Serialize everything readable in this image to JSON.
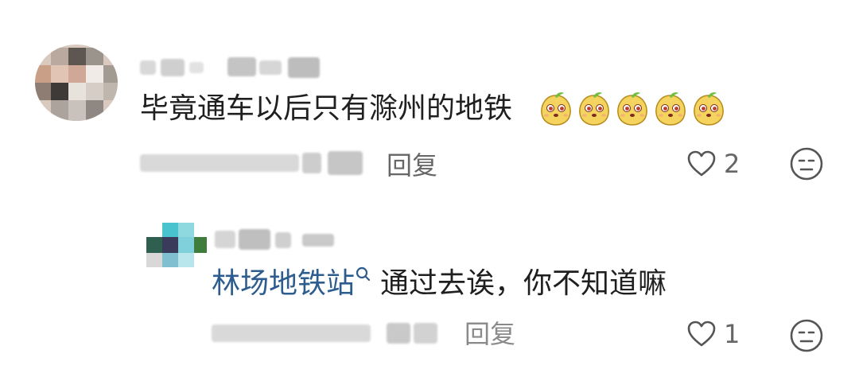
{
  "comment": {
    "text": "毕竟通车以后只有滁州的地铁",
    "emoji_icons": [
      "mango-face-emoji",
      "mango-face-emoji",
      "mango-face-emoji",
      "mango-face-emoji",
      "mango-face-emoji"
    ],
    "reply_label": "回复",
    "like_count": "2"
  },
  "reply": {
    "mention": "林场地铁站",
    "text": "通过去诶，你不知道嘛",
    "reply_label": "回复",
    "like_count": "1"
  },
  "icons": {
    "like": "heart-outline-icon",
    "reaction": "neutral-face-icon",
    "mention_search": "search-icon"
  },
  "colors": {
    "text": "#1f1f1f",
    "meta": "#666666",
    "mention_link": "#2d5c8f",
    "icon": "#555555"
  }
}
